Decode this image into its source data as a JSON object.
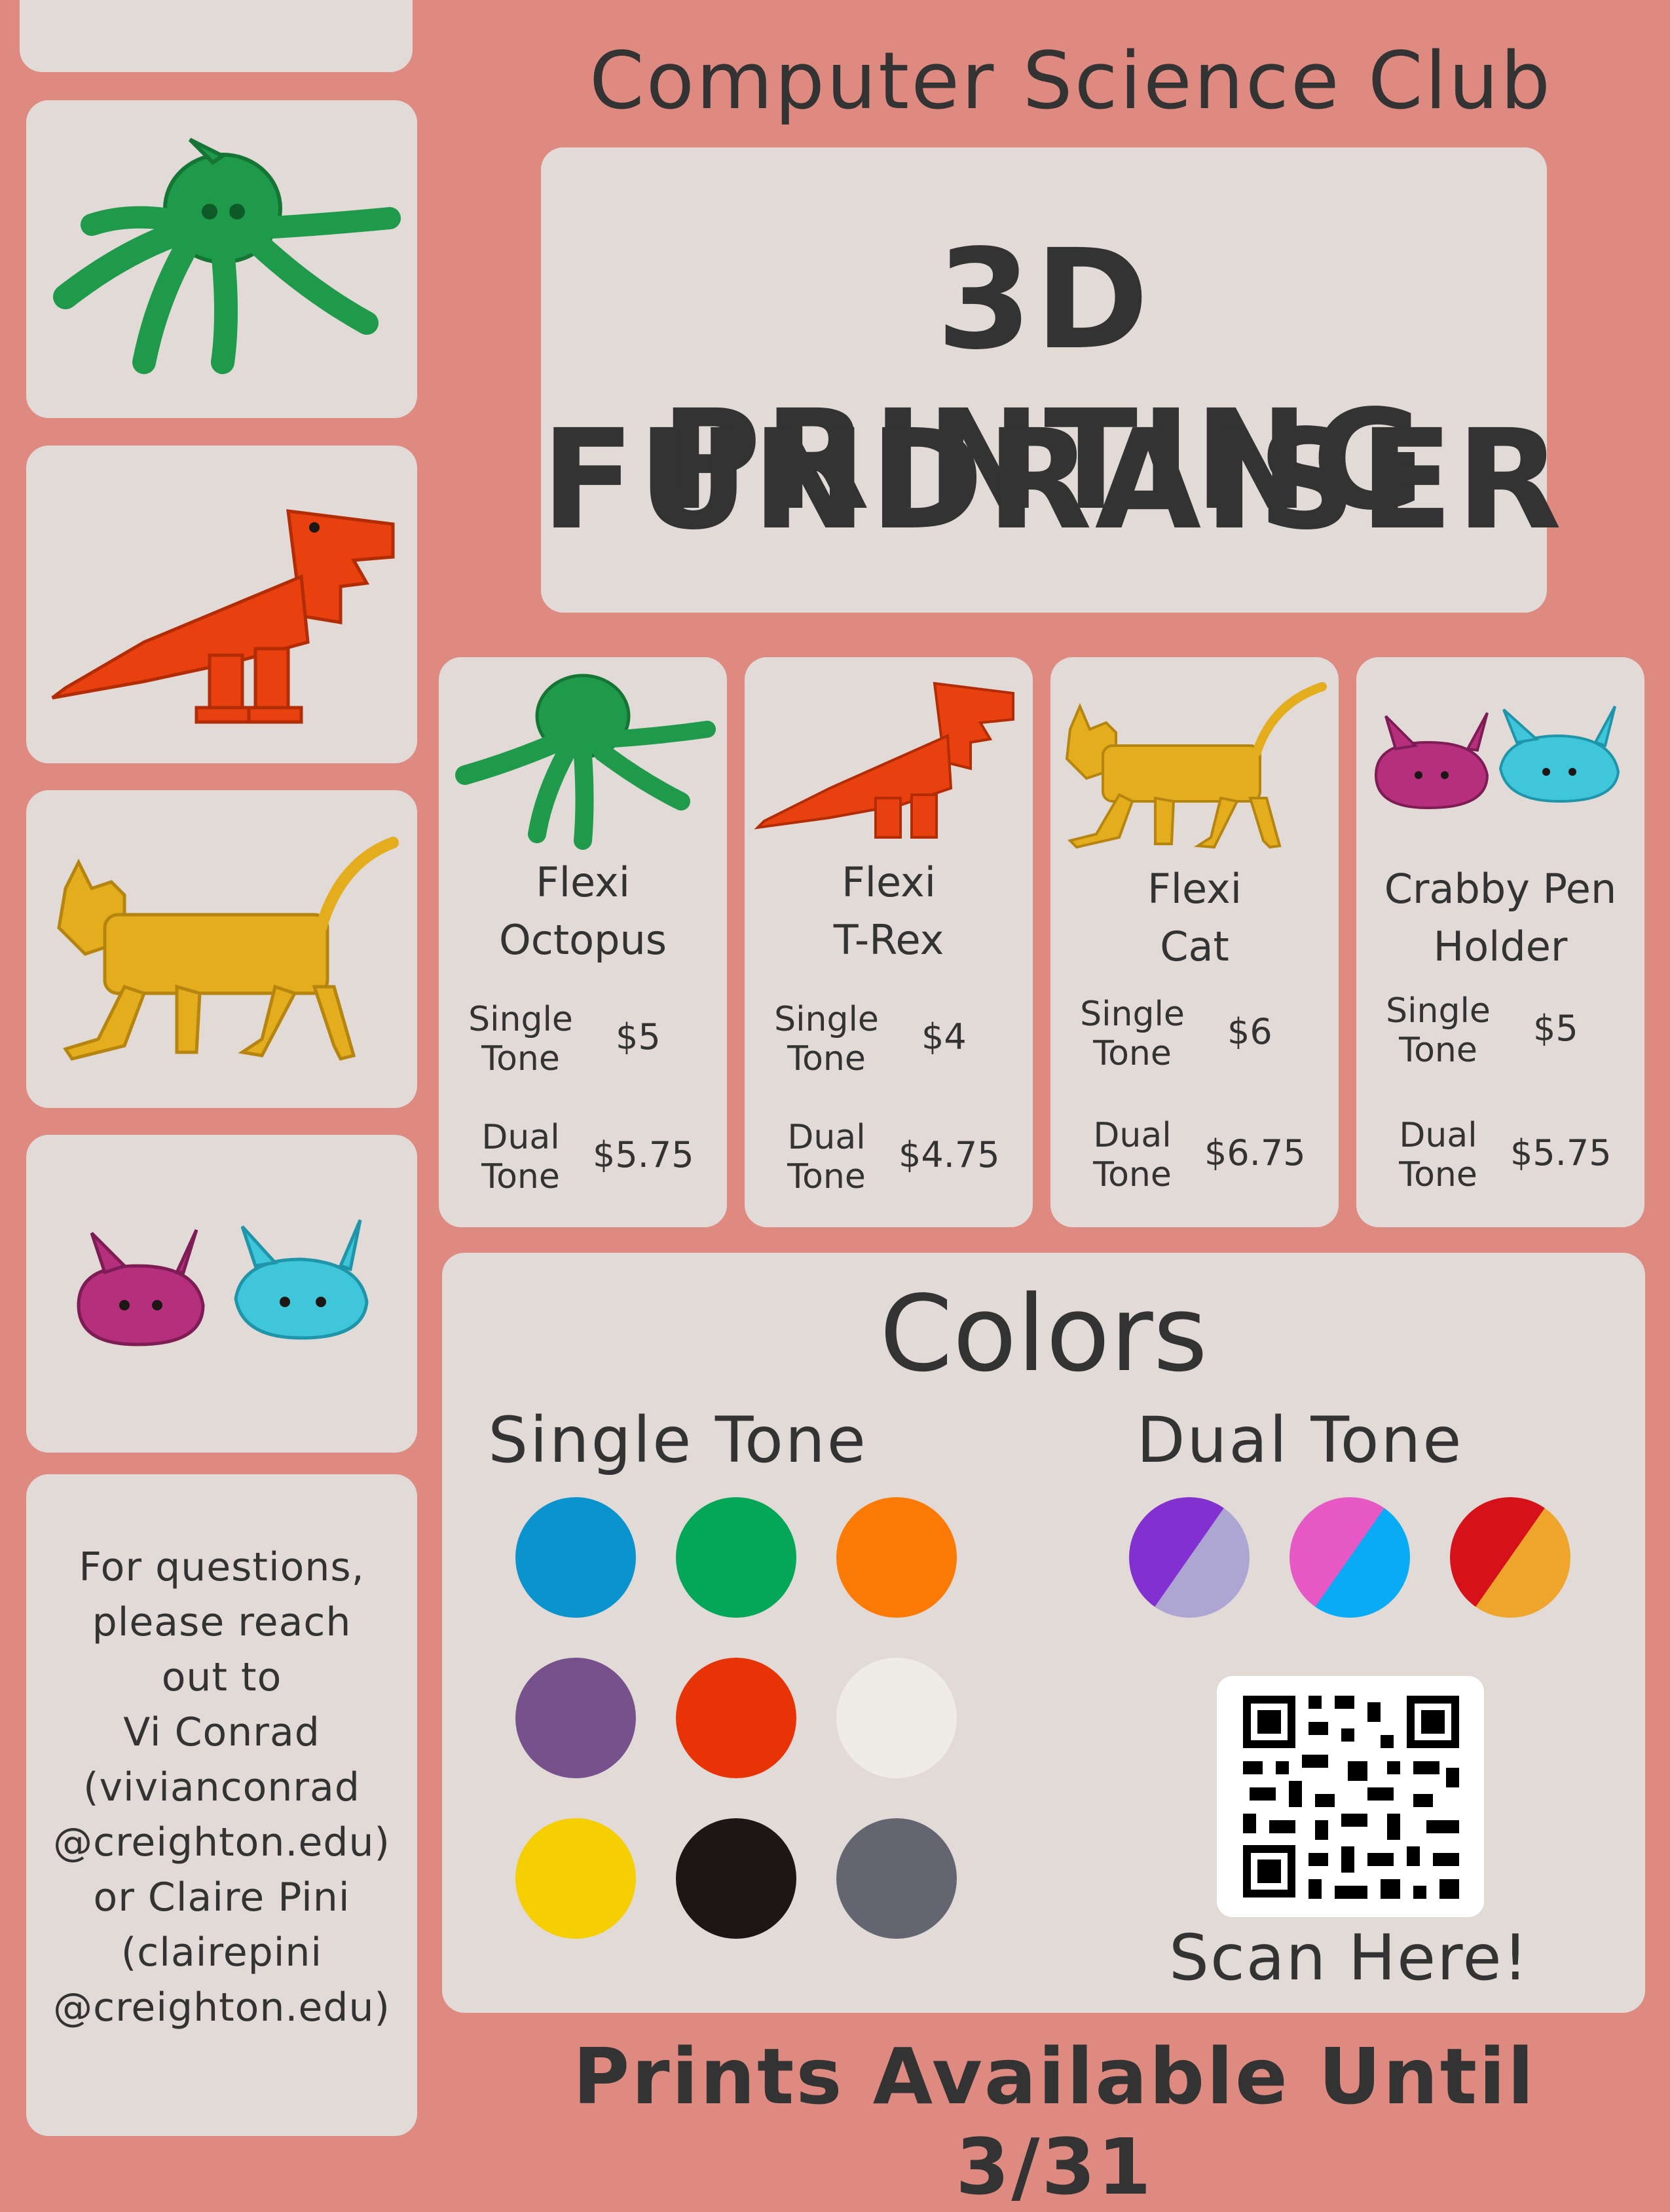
{
  "header": {
    "club": "Computer Science Club",
    "title_line1": "3D PRINTING",
    "title_line2": "FUNDRAISER"
  },
  "products": [
    {
      "name_line1": "Flexi",
      "name_line2": "Octopus",
      "single_label_1": "Single",
      "single_label_2": "Tone",
      "single_price": "$5",
      "dual_label_1": "Dual",
      "dual_label_2": "Tone",
      "dual_price": "$5.75",
      "icon": "octopus-icon"
    },
    {
      "name_line1": "Flexi",
      "name_line2": "T-Rex",
      "single_label_1": "Single",
      "single_label_2": "Tone",
      "single_price": "$4",
      "dual_label_1": "Dual",
      "dual_label_2": "Tone",
      "dual_price": "$4.75",
      "icon": "trex-icon"
    },
    {
      "name_line1": "Flexi",
      "name_line2": "Cat",
      "single_label_1": "Single",
      "single_label_2": "Tone",
      "single_price": "$6",
      "dual_label_1": "Dual",
      "dual_label_2": "Tone",
      "dual_price": "$6.75",
      "icon": "cat-icon"
    },
    {
      "name_line1": "Crabby Pen",
      "name_line2": "Holder",
      "single_label_1": "Single",
      "single_label_2": "Tone",
      "single_price": "$5",
      "dual_label_1": "Dual",
      "dual_label_2": "Tone",
      "dual_price": "$5.75",
      "icon": "crab-icon"
    }
  ],
  "colors": {
    "title": "Colors",
    "single_title": "Single Tone",
    "dual_title": "Dual Tone",
    "single": [
      "#0a93cd",
      "#04a658",
      "#fb7a06",
      "#77518c",
      "#e73306",
      "#efebe7",
      "#f5cf02",
      "#1c1614",
      "#636571"
    ],
    "dual": [
      [
        "#8330d0",
        "#aea6d2"
      ],
      [
        "#e659c4",
        "#0aabf5"
      ],
      [
        "#d6111a",
        "#efa52c"
      ]
    ]
  },
  "qr": {
    "label": "Scan Here!"
  },
  "contact": {
    "lines": [
      "For questions,",
      "please reach",
      "out to",
      "Vi Conrad",
      "(vivianconrad",
      "@creighton.edu)",
      "or Claire Pini",
      "(clairepini",
      "@creighton.edu)"
    ]
  },
  "footer": {
    "text": "Prints Available Until 3/31"
  },
  "palette": {
    "background": "#de8a80",
    "card": "#e1dad6",
    "text": "#333333",
    "octopus": "#1f9a4a",
    "trex": "#e8400f",
    "cat": "#e3ad1d",
    "crab_pink": "#b62f7c",
    "crab_blue": "#40c6da"
  }
}
